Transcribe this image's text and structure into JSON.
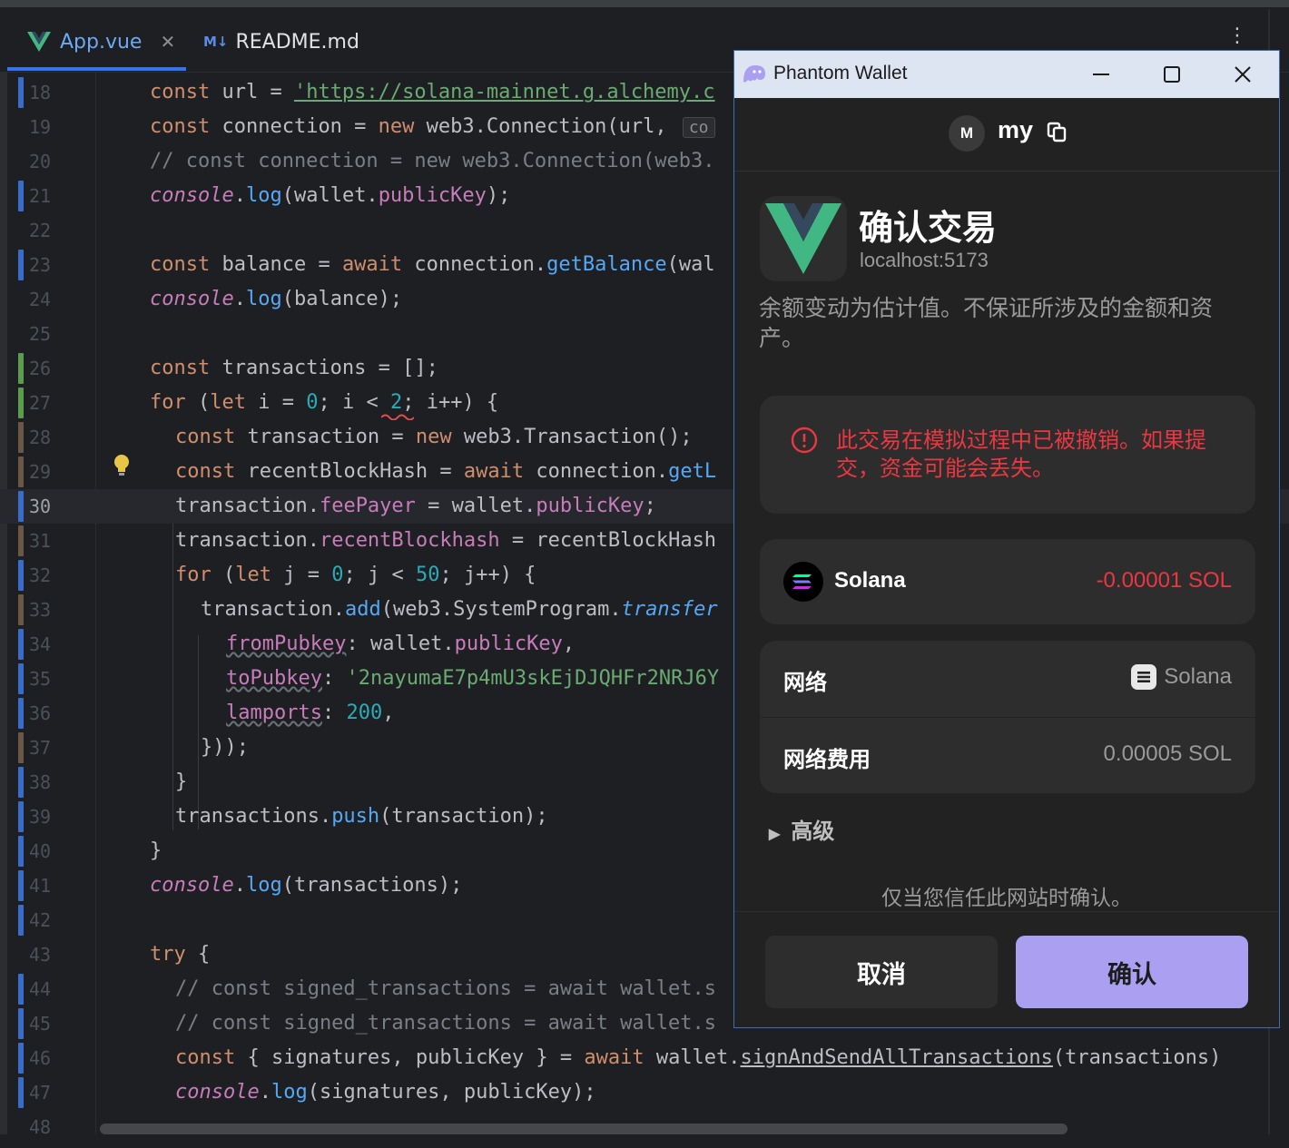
{
  "editor": {
    "tabs": [
      {
        "label": "App.vue",
        "icon": "vue-icon",
        "active": true
      },
      {
        "label": "README.md",
        "icon": "markdown-icon",
        "badge": "M↓",
        "active": false
      }
    ],
    "current_line": 30,
    "lines": [
      {
        "n": "18",
        "vcs": "modified"
      },
      {
        "n": "19",
        "vcs": "none"
      },
      {
        "n": "20",
        "vcs": "none"
      },
      {
        "n": "21",
        "vcs": "modified"
      },
      {
        "n": "22",
        "vcs": "none"
      },
      {
        "n": "23",
        "vcs": "modified"
      },
      {
        "n": "24",
        "vcs": "none"
      },
      {
        "n": "25",
        "vcs": "none"
      },
      {
        "n": "26",
        "vcs": "added"
      },
      {
        "n": "27",
        "vcs": "added"
      },
      {
        "n": "28",
        "vcs": "brown"
      },
      {
        "n": "29",
        "vcs": "brown"
      },
      {
        "n": "30",
        "vcs": "modified"
      },
      {
        "n": "31",
        "vcs": "brown"
      },
      {
        "n": "32",
        "vcs": "modified"
      },
      {
        "n": "33",
        "vcs": "brown"
      },
      {
        "n": "34",
        "vcs": "modified"
      },
      {
        "n": "35",
        "vcs": "modified"
      },
      {
        "n": "36",
        "vcs": "modified"
      },
      {
        "n": "37",
        "vcs": "brown"
      },
      {
        "n": "38",
        "vcs": "modified"
      },
      {
        "n": "39",
        "vcs": "modified"
      },
      {
        "n": "40",
        "vcs": "modified"
      },
      {
        "n": "41",
        "vcs": "modified"
      },
      {
        "n": "42",
        "vcs": "modified"
      },
      {
        "n": "43",
        "vcs": "none"
      },
      {
        "n": "44",
        "vcs": "modified"
      },
      {
        "n": "45",
        "vcs": "modified"
      },
      {
        "n": "46",
        "vcs": "modified"
      },
      {
        "n": "47",
        "vcs": "modified"
      },
      {
        "n": "48",
        "vcs": "none"
      }
    ],
    "code": {
      "l18": {
        "kw": "const",
        "rest": " url = ",
        "str": "'https://solana-mainnet.g.alchemy.c"
      },
      "l19": {
        "kw": "const",
        "rest1": " connection = ",
        "kw2": "new",
        "rest2": " web3.Connection(url, ",
        "param": "co"
      },
      "l20": {
        "cmt": "// const connection = new web3.Connection(web3."
      },
      "l21": {
        "con": "console",
        "dot": ".",
        "fn": "log",
        "rest1": "(wallet.",
        "prop": "publicKey",
        "rest2": ");"
      },
      "l23": {
        "kw": "const",
        "rest1": " balance = ",
        "kw2": "await",
        "rest2": " connection.",
        "fn": "getBalance",
        "rest3": "(wal"
      },
      "l24": {
        "con": "console",
        "dot": ".",
        "fn": "log",
        "rest": "(balance);"
      },
      "l26": {
        "kw": "const",
        "rest": " transactions = [];"
      },
      "l27": {
        "kw": "for",
        "rest1": " (",
        "kw2": "let",
        "rest2": " i = ",
        "num1": "0",
        "rest3": "; i ",
        "lt": "<",
        "rest4": " ",
        "num2": "2",
        "rest5": "; i++) {"
      },
      "l28": {
        "kw": "const",
        "rest1": " transaction = ",
        "kw2": "new",
        "rest2": " web3.Transaction();"
      },
      "l29": {
        "kw": "const",
        "rest1": " recentBlockHash = ",
        "kw2": "await",
        "rest2": " connection.",
        "fn": "getL"
      },
      "l30": {
        "rest1": "transaction.",
        "prop": "feePayer",
        "rest2": " = wallet.",
        "prop2": "publicKey",
        "rest3": ";"
      },
      "l31": {
        "rest1": "transaction.",
        "prop": "recentBlockhash",
        "rest2": " = recentBlockHash"
      },
      "l32": {
        "kw": "for",
        "rest1": " (",
        "kw2": "let",
        "rest2": " j = ",
        "num1": "0",
        "rest3": "; j < ",
        "num2": "50",
        "rest4": "; j++) {"
      },
      "l33": {
        "rest1": "transaction.",
        "fn": "add",
        "rest2": "(web3.SystemProgram.",
        "fn2": "transfer"
      },
      "l34": {
        "prop": "fromPubkey",
        "rest1": ": wallet.",
        "prop2": "publicKey",
        "rest2": ","
      },
      "l35": {
        "prop": "toPubkey",
        "rest1": ": ",
        "str": "'2nayumaE7p4mU3skEjDJQHFr2NRJ6Y"
      },
      "l36": {
        "prop": "lamports",
        "rest1": ": ",
        "num": "200",
        "rest2": ","
      },
      "l37": {
        "rest": "}));"
      },
      "l38": {
        "rest": "}"
      },
      "l39": {
        "rest1": "transactions.",
        "fn": "push",
        "rest2": "(transaction);"
      },
      "l40": {
        "rest": "}"
      },
      "l41": {
        "con": "console",
        "dot": ".",
        "fn": "log",
        "rest": "(transactions);"
      },
      "l43": {
        "kw": "try",
        "rest": " {"
      },
      "l44": {
        "cmt": "// const signed_transactions = await wallet.s"
      },
      "l45": {
        "cmt": "// const signed_transactions = await wallet.s"
      },
      "l46": {
        "kw": "const",
        "rest1": " { signatures, publicKey } = ",
        "kw2": "await",
        "rest2": " wallet.",
        "fn": "signAndSendAllTransactions",
        "rest3": "(transactions)"
      },
      "l47": {
        "con": "console",
        "dot": ".",
        "fn": "log",
        "rest": "(signatures, publicKey);"
      }
    },
    "icons": [
      "vue-icon",
      "markdown-icon",
      "close-icon",
      "more-options-icon",
      "lightbulb-icon"
    ]
  },
  "popup": {
    "window_title": "Phantom Wallet",
    "account_avatar": "M",
    "account_name": "my",
    "site_title": "确认交易",
    "site_host": "localhost:5173",
    "disclaimer": "余额变动为估计值。不保证所涉及的金额和资产。",
    "warning": "此交易在模拟过程中已被撤销。如果提交，资金可能会丢失。",
    "asset_name": "Solana",
    "asset_change": "-0.00001 SOL",
    "network_label": "网络",
    "network_value": "Solana",
    "fee_label": "网络费用",
    "fee_value": "0.00005 SOL",
    "advanced_label": "高级",
    "trust_notice": "仅当您信任此网站时确认。",
    "cancel_label": "取消",
    "confirm_label": "确认"
  },
  "colors": {
    "accent_purple": "#ab9ff2",
    "error_red": "#eb3742",
    "vcs_modified": "#3a6dc9",
    "vcs_added": "#5c9c4f",
    "vcs_brown": "#6b5746"
  }
}
